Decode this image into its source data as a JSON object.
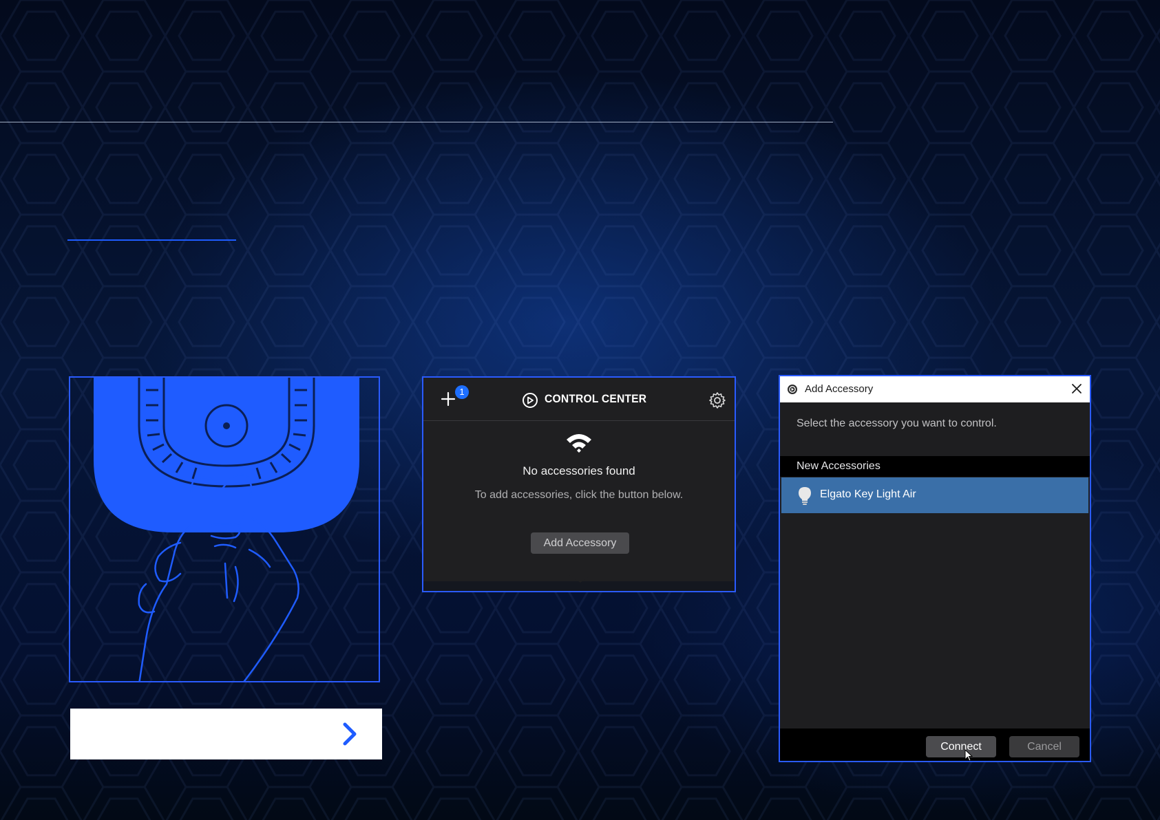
{
  "control_center": {
    "badge_count": "1",
    "title": "CONTROL CENTER",
    "empty_title": "No accessories found",
    "empty_hint": "To add accessories, click the button below.",
    "add_button": "Add Accessory",
    "icons": [
      "plus-icon",
      "elgato-logo-icon",
      "gear-icon",
      "wifi-icon"
    ]
  },
  "add_accessory_dialog": {
    "title": "Add Accessory",
    "prompt": "Select the accessory you want to control.",
    "section_header": "New Accessories",
    "items": [
      {
        "label": "Elgato Key Light Air",
        "icon": "lightbulb-icon",
        "selected": true
      }
    ],
    "connect_button": "Connect",
    "cancel_button": "Cancel"
  },
  "colors": {
    "accent": "#2a5bff",
    "selection": "#3a6fa8",
    "badge": "#1e6fff"
  }
}
